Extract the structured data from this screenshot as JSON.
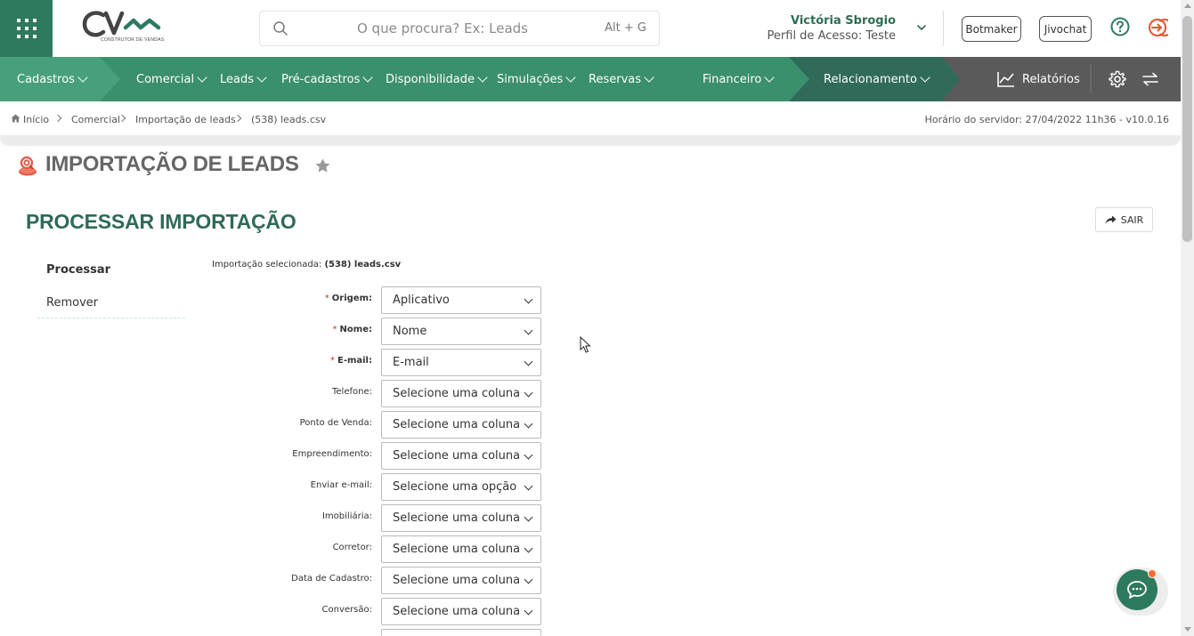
{
  "header": {
    "logo_sub": "CONSTRUTOR DE VENDAS",
    "search_placeholder": "O que procura? Ex: Leads",
    "search_shortcut": "Alt + G",
    "user_name": "Victória Sbrogio",
    "user_profile": "Perfil de Acesso: Teste",
    "botmaker_label": "Botmaker",
    "jivochat_label": "Jivochat"
  },
  "nav": {
    "items": [
      {
        "label": "Cadastros"
      },
      {
        "label": "Comercial"
      },
      {
        "label": "Leads"
      },
      {
        "label": "Pré-cadastros"
      },
      {
        "label": "Disponibilidade"
      },
      {
        "label": "Simulações"
      },
      {
        "label": "Reservas"
      },
      {
        "label": "Financeiro"
      },
      {
        "label": "Relacionamento"
      }
    ],
    "reports_label": "Relatórios"
  },
  "breadcrumb": {
    "items": [
      "Início",
      "Comercial",
      "Importação de leads",
      "(538) leads.csv"
    ],
    "server_time": "Horário do servidor: 27/04/2022 11h36 - v10.0.16"
  },
  "page": {
    "title": "IMPORTAÇÃO DE LEADS",
    "section_title": "PROCESSAR IMPORTAÇÃO",
    "exit_label": "SAIR"
  },
  "sidebar": {
    "items": [
      {
        "label": "Processar",
        "active": true
      },
      {
        "label": "Remover",
        "active": false
      }
    ]
  },
  "form": {
    "selected_prefix": "Importação selecionada:",
    "selected_value": "(538) leads.csv",
    "fields": [
      {
        "label": "Origem:",
        "value": "Aplicativo",
        "required": true
      },
      {
        "label": "Nome:",
        "value": "Nome",
        "required": true
      },
      {
        "label": "E-mail:",
        "value": "E-mail",
        "required": true
      },
      {
        "label": "Telefone:",
        "value": "Selecione uma coluna",
        "required": false
      },
      {
        "label": "Ponto de Venda:",
        "value": "Selecione uma coluna",
        "required": false
      },
      {
        "label": "Empreendimento:",
        "value": "Selecione uma coluna",
        "required": false
      },
      {
        "label": "Enviar e-mail:",
        "value": "Selecione uma opção",
        "required": false
      },
      {
        "label": "Imobiliária:",
        "value": "Selecione uma coluna",
        "required": false
      },
      {
        "label": "Corretor:",
        "value": "Selecione uma coluna",
        "required": false
      },
      {
        "label": "Data de Cadastro:",
        "value": "Selecione uma coluna",
        "required": false
      },
      {
        "label": "Conversão:",
        "value": "Selecione uma coluna",
        "required": false
      }
    ]
  },
  "colors": {
    "brand_green": "#2d7a5e",
    "nav_green": "#3a8f6c",
    "nav_dark": "#2f6a5a",
    "nav_gray": "#5a5a5a",
    "logout_red": "#e5532d",
    "chat_dot": "#ff6a2a"
  },
  "icons": [
    "apps-grid-icon",
    "search-icon",
    "chevron-down-icon",
    "help-icon",
    "logout-icon",
    "chart-line-icon",
    "gear-icon",
    "swap-icon",
    "home-icon",
    "star-icon",
    "share-arrow-icon",
    "chat-icon",
    "page-title-icon"
  ]
}
